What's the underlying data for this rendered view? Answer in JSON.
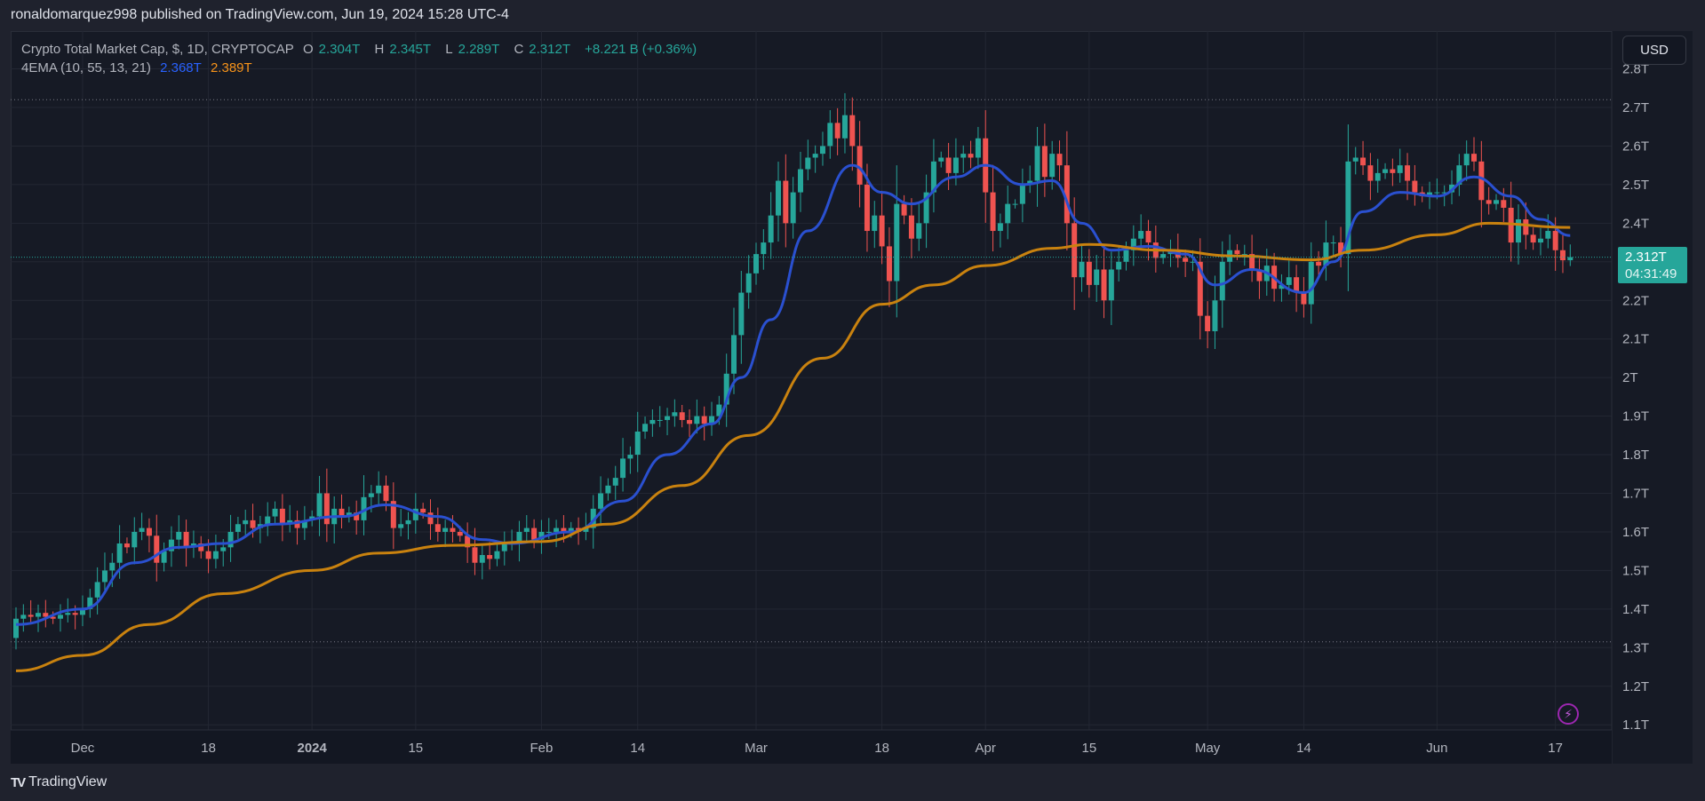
{
  "publish_line": "ronaldomarquez998 published on TradingView.com, Jun 19, 2024 15:28 UTC-4",
  "legend": {
    "symbol": "Crypto Total Market Cap, $, 1D, CRYPTOCAP",
    "o_label": "O",
    "o": "2.304T",
    "h_label": "H",
    "h": "2.345T",
    "l_label": "L",
    "l": "2.289T",
    "c_label": "C",
    "c": "2.312T",
    "change": "+8.221 B (+0.36%)",
    "indicator": "4EMA (10, 55, 13, 21)",
    "ema_fast": "2.368T",
    "ema_slow": "2.389T"
  },
  "currency_button": "USD",
  "price_tag": {
    "value": "2.312T",
    "countdown": "04:31:49"
  },
  "footer_brand": "TradingView",
  "footer_logo": "TV",
  "icons": {
    "alert": "lightning-icon",
    "brand": "tradingview-logo"
  },
  "colors": {
    "up": "#26a69a",
    "down": "#ef5350",
    "ema_fast": "#2a50d0",
    "ema_slow": "#c9820f",
    "price_line": "#26a69a",
    "background": "#161a25"
  },
  "chart_data": {
    "type": "candlestick",
    "title": "Crypto Total Market Cap, $, 1D, CRYPTOCAP",
    "unit": "T USD",
    "ylim": [
      1.1,
      2.8
    ],
    "grid": true,
    "price_axis_labels": [
      "2.8T",
      "2.7T",
      "2.6T",
      "2.5T",
      "2.4T",
      "2.3T",
      "2.2T",
      "2.1T",
      "2T",
      "1.9T",
      "1.8T",
      "1.7T",
      "1.6T",
      "1.5T",
      "1.4T",
      "1.3T",
      "1.2T",
      "1.1T"
    ],
    "price_axis_values": [
      2.8,
      2.7,
      2.6,
      2.5,
      2.4,
      2.3,
      2.2,
      2.1,
      2.0,
      1.9,
      1.8,
      1.7,
      1.6,
      1.5,
      1.4,
      1.3,
      1.2,
      1.1
    ],
    "time_axis": [
      {
        "label": "Dec",
        "date": "2023-12-01"
      },
      {
        "label": "18",
        "date": "2023-12-18"
      },
      {
        "label": "2024",
        "date": "2024-01-01",
        "bold": true
      },
      {
        "label": "15",
        "date": "2024-01-15"
      },
      {
        "label": "Feb",
        "date": "2024-02-01"
      },
      {
        "label": "14",
        "date": "2024-02-14"
      },
      {
        "label": "Mar",
        "date": "2024-03-01"
      },
      {
        "label": "18",
        "date": "2024-03-18"
      },
      {
        "label": "Apr",
        "date": "2024-04-01"
      },
      {
        "label": "15",
        "date": "2024-04-15"
      },
      {
        "label": "May",
        "date": "2024-05-01"
      },
      {
        "label": "14",
        "date": "2024-05-14"
      },
      {
        "label": "Jun",
        "date": "2024-06-01"
      },
      {
        "label": "17",
        "date": "2024-06-17"
      }
    ],
    "range_high": 2.72,
    "range_low": 1.315,
    "last_price": 2.312,
    "last_candle": {
      "o": 2.304,
      "h": 2.345,
      "l": 2.289,
      "c": 2.312
    },
    "first_open": 1.325,
    "candles": [
      {
        "month": "2023-11",
        "start_day": 22,
        "close": [
          1.375,
          1.385,
          1.38,
          1.39,
          1.38,
          1.375,
          1.385,
          1.39,
          1.385
        ]
      },
      {
        "month": "2023-12",
        "start_day": 1,
        "close": [
          1.4,
          1.43,
          1.47,
          1.5,
          1.52,
          1.57,
          1.56,
          1.6,
          1.61,
          1.59,
          1.52,
          1.55,
          1.58,
          1.6,
          1.56,
          1.57,
          1.55,
          1.53,
          1.55,
          1.56,
          1.6,
          1.62,
          1.63,
          1.61,
          1.62,
          1.64,
          1.66,
          1.62,
          1.63,
          1.61,
          1.63
        ]
      },
      {
        "month": "2024-01",
        "start_day": 1,
        "close": [
          1.64,
          1.7,
          1.62,
          1.66,
          1.64,
          1.65,
          1.63,
          1.69,
          1.7,
          1.72,
          1.68,
          1.61,
          1.62,
          1.63,
          1.66,
          1.65,
          1.62,
          1.6,
          1.61,
          1.6,
          1.59,
          1.56,
          1.52,
          1.54,
          1.53,
          1.55,
          1.57,
          1.57,
          1.6,
          1.61,
          1.58
        ]
      },
      {
        "month": "2024-02",
        "start_day": 1,
        "close": [
          1.6,
          1.6,
          1.61,
          1.6,
          1.61,
          1.6,
          1.61,
          1.66,
          1.7,
          1.72,
          1.74,
          1.79,
          1.8,
          1.86,
          1.88,
          1.89,
          1.89,
          1.9,
          1.91,
          1.89,
          1.88,
          1.9,
          1.88,
          1.9,
          1.93,
          2.01,
          2.11,
          2.22,
          2.27
        ]
      },
      {
        "month": "2024-03",
        "start_day": 1,
        "close": [
          2.32,
          2.35,
          2.42,
          2.51,
          2.4,
          2.48,
          2.54,
          2.57,
          2.58,
          2.6,
          2.66,
          2.62,
          2.68,
          2.6,
          2.5,
          2.38,
          2.42,
          2.34,
          2.25,
          2.45,
          2.42,
          2.36,
          2.4,
          2.48,
          2.56,
          2.57,
          2.53,
          2.57,
          2.58,
          2.57,
          2.62
        ]
      },
      {
        "month": "2024-04",
        "start_day": 1,
        "close": [
          2.48,
          2.38,
          2.4,
          2.45,
          2.45,
          2.5,
          2.51,
          2.6,
          2.52,
          2.58,
          2.55,
          2.4,
          2.26,
          2.3,
          2.24,
          2.28,
          2.2,
          2.28,
          2.3,
          2.33,
          2.36,
          2.38,
          2.35,
          2.31,
          2.32,
          2.33,
          2.31,
          2.3,
          2.3,
          2.16
        ]
      },
      {
        "month": "2024-05",
        "start_day": 1,
        "close": [
          2.12,
          2.2,
          2.3,
          2.33,
          2.32,
          2.32,
          2.28,
          2.25,
          2.29,
          2.23,
          2.24,
          2.26,
          2.22,
          2.19,
          2.3,
          2.29,
          2.35,
          2.35,
          2.32,
          2.56,
          2.57,
          2.55,
          2.51,
          2.53,
          2.54,
          2.53,
          2.55,
          2.51,
          2.48,
          2.47,
          2.48
        ]
      },
      {
        "month": "2024-06",
        "start_day": 1,
        "close": [
          2.48,
          2.48,
          2.5,
          2.55,
          2.58,
          2.56,
          2.46,
          2.45,
          2.46,
          2.44,
          2.35,
          2.41,
          2.37,
          2.35,
          2.36,
          2.38,
          2.33,
          2.304,
          2.312
        ]
      }
    ],
    "series": [
      {
        "name": "EMA 10",
        "color_key": "ema_fast",
        "points": [
          [
            "2023-11-22",
            1.36
          ],
          [
            "2023-12-01",
            1.4
          ],
          [
            "2023-12-08",
            1.52
          ],
          [
            "2023-12-14",
            1.56
          ],
          [
            "2023-12-20",
            1.57
          ],
          [
            "2023-12-27",
            1.62
          ],
          [
            "2024-01-05",
            1.64
          ],
          [
            "2024-01-11",
            1.67
          ],
          [
            "2024-01-18",
            1.64
          ],
          [
            "2024-01-24",
            1.58
          ],
          [
            "2024-01-28",
            1.57
          ],
          [
            "2024-02-05",
            1.6
          ],
          [
            "2024-02-12",
            1.68
          ],
          [
            "2024-02-18",
            1.8
          ],
          [
            "2024-02-24",
            1.88
          ],
          [
            "2024-02-28",
            2.0
          ],
          [
            "2024-03-03",
            2.15
          ],
          [
            "2024-03-08",
            2.38
          ],
          [
            "2024-03-14",
            2.55
          ],
          [
            "2024-03-18",
            2.48
          ],
          [
            "2024-03-22",
            2.45
          ],
          [
            "2024-03-28",
            2.52
          ],
          [
            "2024-04-01",
            2.55
          ],
          [
            "2024-04-06",
            2.5
          ],
          [
            "2024-04-10",
            2.51
          ],
          [
            "2024-04-14",
            2.4
          ],
          [
            "2024-04-18",
            2.33
          ],
          [
            "2024-04-23",
            2.34
          ],
          [
            "2024-04-28",
            2.32
          ],
          [
            "2024-05-02",
            2.24
          ],
          [
            "2024-05-07",
            2.28
          ],
          [
            "2024-05-14",
            2.22
          ],
          [
            "2024-05-18",
            2.3
          ],
          [
            "2024-05-22",
            2.43
          ],
          [
            "2024-05-27",
            2.48
          ],
          [
            "2024-06-01",
            2.47
          ],
          [
            "2024-06-06",
            2.52
          ],
          [
            "2024-06-11",
            2.47
          ],
          [
            "2024-06-15",
            2.41
          ],
          [
            "2024-06-19",
            2.368
          ]
        ]
      },
      {
        "name": "EMA 55",
        "color_key": "ema_slow",
        "points": [
          [
            "2023-11-22",
            1.24
          ],
          [
            "2023-12-01",
            1.28
          ],
          [
            "2023-12-10",
            1.36
          ],
          [
            "2023-12-20",
            1.44
          ],
          [
            "2024-01-01",
            1.5
          ],
          [
            "2024-01-10",
            1.545
          ],
          [
            "2024-01-20",
            1.565
          ],
          [
            "2024-02-01",
            1.575
          ],
          [
            "2024-02-10",
            1.62
          ],
          [
            "2024-02-20",
            1.72
          ],
          [
            "2024-02-29",
            1.85
          ],
          [
            "2024-03-10",
            2.05
          ],
          [
            "2024-03-18",
            2.19
          ],
          [
            "2024-03-25",
            2.24
          ],
          [
            "2024-04-01",
            2.29
          ],
          [
            "2024-04-10",
            2.335
          ],
          [
            "2024-04-15",
            2.345
          ],
          [
            "2024-04-25",
            2.33
          ],
          [
            "2024-05-05",
            2.315
          ],
          [
            "2024-05-15",
            2.305
          ],
          [
            "2024-05-22",
            2.33
          ],
          [
            "2024-06-01",
            2.37
          ],
          [
            "2024-06-08",
            2.4
          ],
          [
            "2024-06-19",
            2.389
          ]
        ]
      }
    ]
  }
}
